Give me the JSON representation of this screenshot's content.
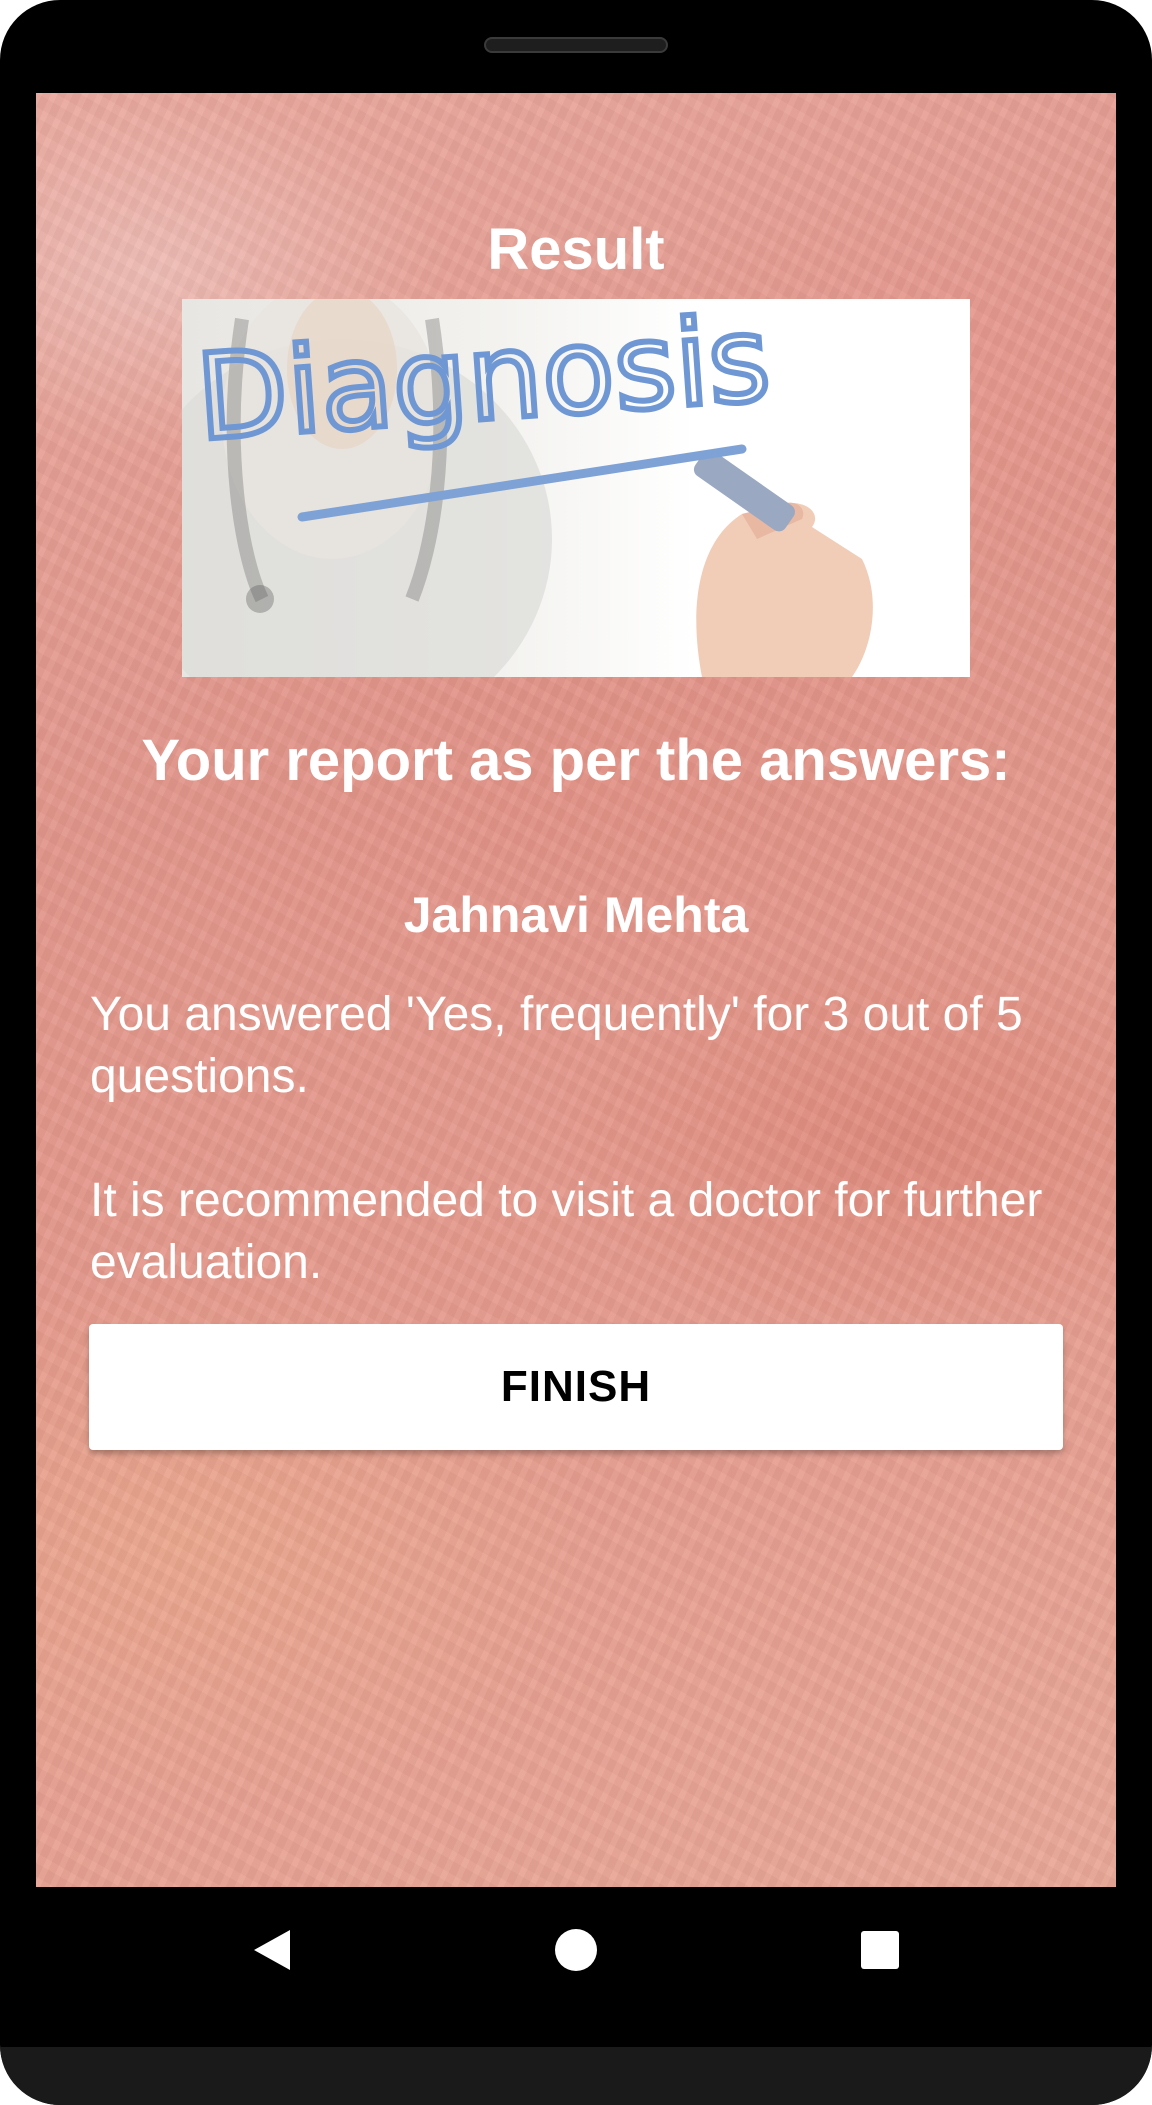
{
  "screen": {
    "title": "Result",
    "image": {
      "text": "Diagnosis",
      "colors": {
        "ink": "#6f97d3",
        "background": "#ffffff"
      }
    },
    "report_heading": "Your report as per the answers:",
    "patient_name": "Jahnavi Mehta",
    "answer_summary": "You answered 'Yes, frequently' for 3 out of 5 questions.",
    "recommendation": "It is recommended to visit a doctor for further evaluation.",
    "finish_label": "FINISH"
  },
  "nav": {
    "back_icon": "back-triangle",
    "home_icon": "home-circle",
    "recents_icon": "recents-square"
  },
  "colors": {
    "background": "#e59a8d",
    "text": "#ffffff",
    "button_bg": "#ffffff",
    "button_text": "#000000",
    "device_frame": "#000000"
  }
}
